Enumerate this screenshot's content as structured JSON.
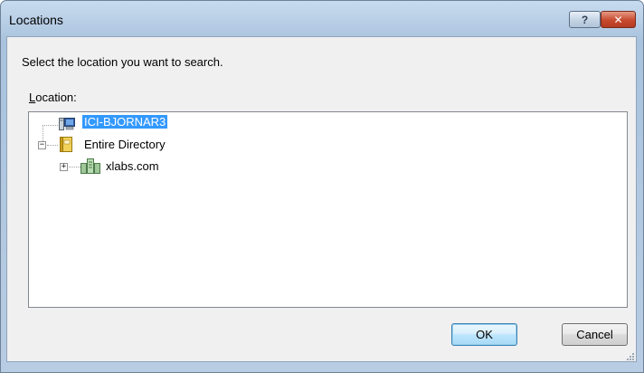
{
  "window": {
    "title": "Locations",
    "help_glyph": "?",
    "close_glyph": "✕"
  },
  "instruction": "Select the location you want to search.",
  "location_label": {
    "accel": "L",
    "rest": "ocation:"
  },
  "tree": {
    "items": [
      {
        "label": "ICI-BJORNAR3",
        "icon": "computer-icon",
        "selected": true
      },
      {
        "label": "Entire Directory",
        "icon": "directory-book-icon",
        "expanded": true,
        "expander": "−"
      },
      {
        "label": "xlabs.com",
        "icon": "domain-icon",
        "expanded": false,
        "expander": "+"
      }
    ]
  },
  "buttons": {
    "ok": "OK",
    "cancel": "Cancel"
  },
  "colors": {
    "selection": "#3399ff",
    "title_bar": "#b9cfe6",
    "close_red": "#c84a2e"
  }
}
